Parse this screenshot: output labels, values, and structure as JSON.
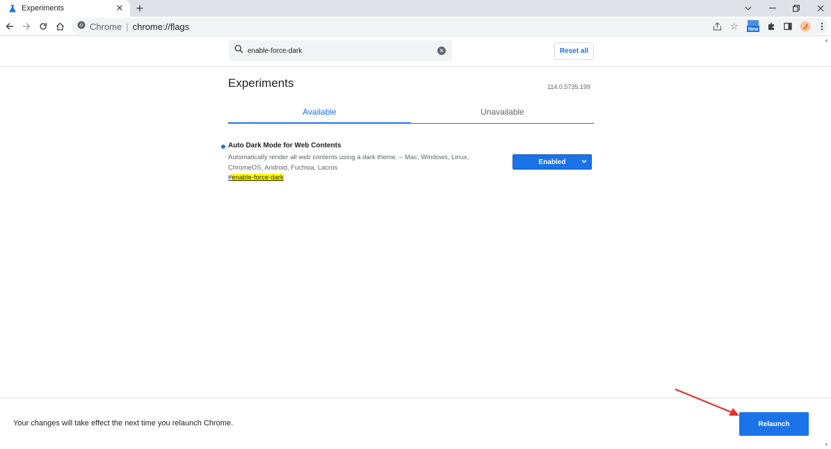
{
  "browser": {
    "tab_title": "Experiments",
    "new_tab_icon": "plus-icon",
    "window_controls": [
      "chevron-down-icon",
      "minimize-icon",
      "restore-icon",
      "close-icon"
    ],
    "omnibox": {
      "site_label": "Chrome",
      "url": "chrome://flags"
    },
    "toolbar_icons": [
      "share-icon",
      "bookmark-star-icon",
      "new-badge-extension-icon",
      "puzzle-extensions-icon",
      "side-panel-icon",
      "profile-avatar-icon",
      "more-menu-icon"
    ],
    "badge_text": "New"
  },
  "search": {
    "value": "enable-force-dark",
    "reset_label": "Reset all"
  },
  "page": {
    "title": "Experiments",
    "version": "114.0.5735.199",
    "tabs": [
      {
        "label": "Available",
        "active": true
      },
      {
        "label": "Unavailable",
        "active": false
      }
    ]
  },
  "flag": {
    "name": "Auto Dark Mode for Web Contents",
    "description": "Automatically render all web contents using a dark theme. – Mac, Windows, Linux, ChromeOS, Android, Fuchsia, Lacros",
    "hash": "#",
    "anchor": "enable-force-dark",
    "selected_option": "Enabled"
  },
  "relaunch": {
    "message": "Your changes will take effect the next time you relaunch Chrome.",
    "button_label": "Relaunch"
  },
  "colors": {
    "accent": "#1a73e8",
    "highlight": "#ffff00",
    "annotation_arrow": "#e8312a"
  }
}
